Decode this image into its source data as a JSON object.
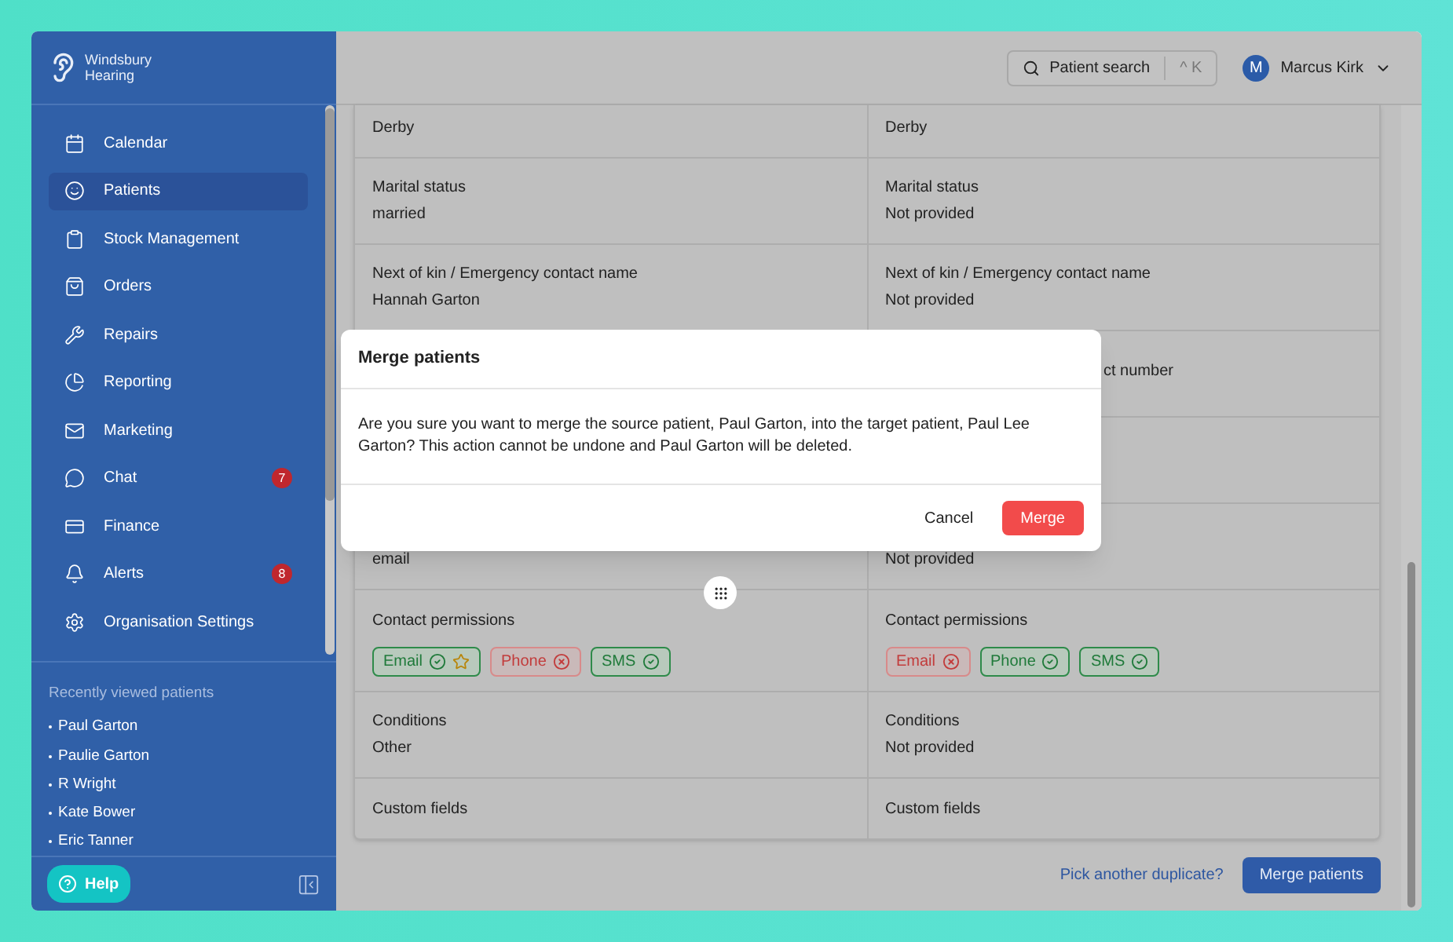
{
  "brand": {
    "lines": [
      "Windsbury",
      "Hearing"
    ]
  },
  "nav": {
    "items": [
      {
        "label": "Calendar",
        "selected": false
      },
      {
        "label": "Patients",
        "selected": true
      },
      {
        "label": "Stock Management",
        "selected": false
      },
      {
        "label": "Orders",
        "selected": false
      },
      {
        "label": "Repairs",
        "selected": false
      },
      {
        "label": "Reporting",
        "selected": false
      },
      {
        "label": "Marketing",
        "selected": false
      },
      {
        "label": "Chat",
        "selected": false,
        "badge": "7"
      },
      {
        "label": "Finance",
        "selected": false
      },
      {
        "label": "Alerts",
        "selected": false,
        "badge": "8"
      },
      {
        "label": "Organisation Settings",
        "selected": false
      }
    ]
  },
  "recent": {
    "title": "Recently viewed patients",
    "items": [
      "Paul Garton",
      "Paulie Garton",
      "R Wright",
      "Kate Bower",
      "Eric Tanner"
    ]
  },
  "help": {
    "label": "Help"
  },
  "header": {
    "search": {
      "label": "Patient search",
      "shortcut": "^ K"
    },
    "user": {
      "initial": "M",
      "name": "Marcus Kirk"
    }
  },
  "rows": [
    {
      "left": {
        "kind": "field",
        "value": "Derby"
      },
      "right": {
        "kind": "field",
        "value": "Derby"
      }
    },
    {
      "left": {
        "kind": "field",
        "label": "Marital status",
        "value": "married"
      },
      "right": {
        "kind": "field",
        "label": "Marital status",
        "value": "Not provided"
      }
    },
    {
      "left": {
        "kind": "field",
        "label": "Next of kin / Emergency contact name",
        "value": "Hannah Garton"
      },
      "right": {
        "kind": "field",
        "label": "Next of kin / Emergency contact name",
        "value": "Not provided"
      }
    },
    {
      "left": {
        "kind": "obscured"
      },
      "right": {
        "kind": "obscured",
        "label": "ct number"
      }
    },
    {
      "left": {
        "kind": "obscured"
      },
      "right": {
        "kind": "obscured"
      }
    },
    {
      "left": {
        "kind": "field",
        "value": "email"
      },
      "right": {
        "kind": "field",
        "value": "Not provided"
      }
    },
    {
      "left": {
        "kind": "permissions",
        "label": "Contact permissions",
        "chips": [
          {
            "label": "Email",
            "allowed": true,
            "starred": true
          },
          {
            "label": "Phone",
            "allowed": false,
            "starred": false
          },
          {
            "label": "SMS",
            "allowed": true,
            "starred": false
          }
        ]
      },
      "right": {
        "kind": "permissions",
        "label": "Contact permissions",
        "chips": [
          {
            "label": "Email",
            "allowed": false,
            "starred": false
          },
          {
            "label": "Phone",
            "allowed": true,
            "starred": false
          },
          {
            "label": "SMS",
            "allowed": true,
            "starred": false
          }
        ]
      }
    },
    {
      "left": {
        "kind": "field",
        "label": "Conditions",
        "value": "Other"
      },
      "right": {
        "kind": "field",
        "label": "Conditions",
        "value": "Not provided"
      }
    },
    {
      "left": {
        "kind": "field",
        "label": "Custom fields"
      },
      "right": {
        "kind": "field",
        "label": "Custom fields"
      }
    }
  ],
  "footer": {
    "link": "Pick another duplicate?",
    "button": "Merge patients"
  },
  "modal": {
    "title": "Merge patients",
    "message": "Are you sure you want to merge the source patient, Paul Garton, into the target patient, Paul Lee Garton? This action cannot be undone and Paul Garton will be deleted.",
    "cancel": "Cancel",
    "confirm": "Merge"
  }
}
